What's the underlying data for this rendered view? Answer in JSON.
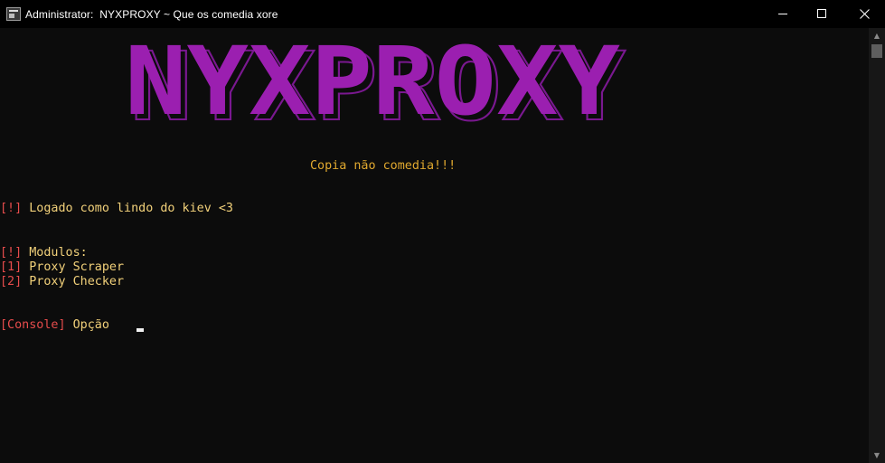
{
  "window": {
    "title": "Administrator:  NYXPROXY ~ Que os comedia xore"
  },
  "colors": {
    "banner": "#9b1fb0",
    "banner_outline": "#7a1890",
    "tagline": "#e1a92f",
    "bracket": "#e74c4c",
    "text": "#f2d17a"
  },
  "banner": {
    "text": "NYXPROXY"
  },
  "tagline": "Copia não comedia!!!",
  "lines": {
    "login_tag": "[!]",
    "login_text": " Logado como lindo do kiev <3",
    "modules_tag": "[!]",
    "modules_text": " Modulos:",
    "opt1_tag": "[1]",
    "opt1_text": " Proxy Scraper",
    "opt2_tag": "[2]",
    "opt2_text": " Proxy Checker",
    "prompt_tag": "[Console]",
    "prompt_text": " Opção"
  },
  "icons": {
    "app": "console-app-icon",
    "minimize": "minimize-icon",
    "maximize": "maximize-icon",
    "close": "close-icon",
    "scroll_up": "arrow-up-icon",
    "scroll_down": "arrow-down-icon"
  }
}
